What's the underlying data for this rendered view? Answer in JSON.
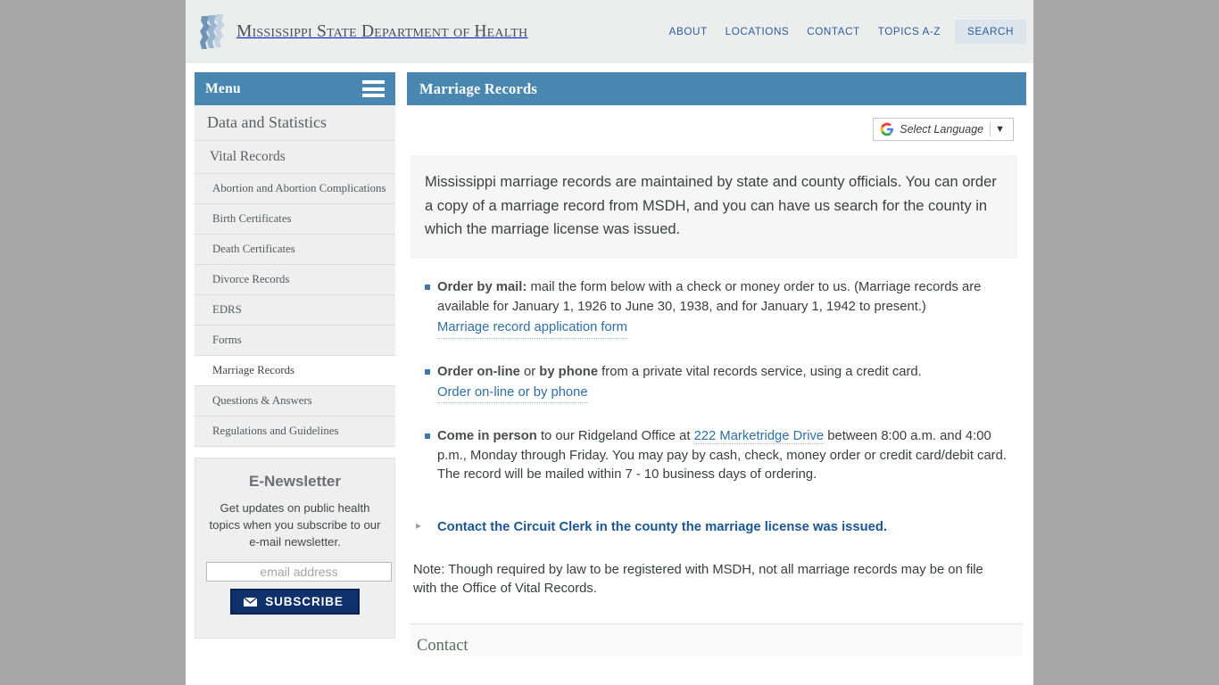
{
  "site": {
    "logo_icon": "msdh-profile-logo-icon",
    "title": "Mississippi State Department of Health",
    "nav": [
      {
        "label": "ABOUT",
        "name": "nav-about"
      },
      {
        "label": "LOCATIONS",
        "name": "nav-locations"
      },
      {
        "label": "CONTACT",
        "name": "nav-contact"
      },
      {
        "label": "TOPICS A-Z",
        "name": "nav-topics-az"
      },
      {
        "label": "SEARCH",
        "name": "nav-search"
      }
    ]
  },
  "sidebar": {
    "menu_label": "Menu",
    "hamburger_icon": "hamburger-menu-icon",
    "items": [
      {
        "label": "Data and Statistics",
        "level": 0,
        "active": false
      },
      {
        "label": "Vital Records",
        "level": 1,
        "active": false
      },
      {
        "label": "Abortion and Abortion Complications",
        "level": 2,
        "active": false
      },
      {
        "label": "Birth Certificates",
        "level": 2,
        "active": false
      },
      {
        "label": "Death Certificates",
        "level": 2,
        "active": false
      },
      {
        "label": "Divorce Records",
        "level": 2,
        "active": false
      },
      {
        "label": "EDRS",
        "level": 2,
        "active": false
      },
      {
        "label": "Forms",
        "level": 2,
        "active": false
      },
      {
        "label": "Marriage Records",
        "level": 2,
        "active": true
      },
      {
        "label": "Questions & Answers",
        "level": 2,
        "active": false
      },
      {
        "label": "Regulations and Guidelines",
        "level": 2,
        "active": false
      }
    ],
    "newsletter": {
      "heading": "E-Newsletter",
      "description": "Get updates on public health topics when you subscribe to our e-mail newsletter.",
      "email_placeholder": "email address",
      "email_value": "",
      "subscribe_label": "SUBSCRIBE",
      "subscribe_icon": "envelope-icon"
    }
  },
  "main": {
    "page_title": "Marriage Records",
    "language_widget": {
      "icon": "google-g-icon",
      "label": "Select Language",
      "caret": "▼"
    },
    "intro": "Mississippi marriage records are maintained by state and county officials. You can order a copy of a marriage record from MSDH, and you can have us search for the county in which the marriage license was issued.",
    "options": [
      {
        "lead": "Order by mail:",
        "body": " mail the form below with a check or money order to us. (Marriage records are available for January 1, 1926 to June 30, 1938, and for January 1, 1942 to present.)",
        "link": "Marriage record application form"
      },
      {
        "lead": "Order on-line",
        "mid": " or ",
        "lead2": "by phone",
        "body": " from a private vital records service, using a credit card.",
        "link": "Order on-line or by phone"
      },
      {
        "lead": "Come in person",
        "body_a": " to our Ridgeland Office at ",
        "inline_link": "222 Marketridge Drive",
        "body_b": " between 8:00 a.m. and 4:00 p.m., Monday through Friday. You may pay by cash, check, money order or credit card/debit card. The record will be mailed within 7 - 10 business days of ordering."
      }
    ],
    "clerk_link": "Contact the Circuit Clerk in the county the marriage license was issued.",
    "note": "Note: Though required by law to be registered with MSDH, not all marriage records may be on file with the Office of Vital Records.",
    "contact_heading": "Contact"
  },
  "colors": {
    "accent_blue": "#4a87b0",
    "link_blue": "#2f6ea5",
    "nav_blue": "#2c5d9b",
    "subscribe_navy": "#10306b",
    "page_bg": "#a8a8a8",
    "contact_green": "#56715b"
  }
}
